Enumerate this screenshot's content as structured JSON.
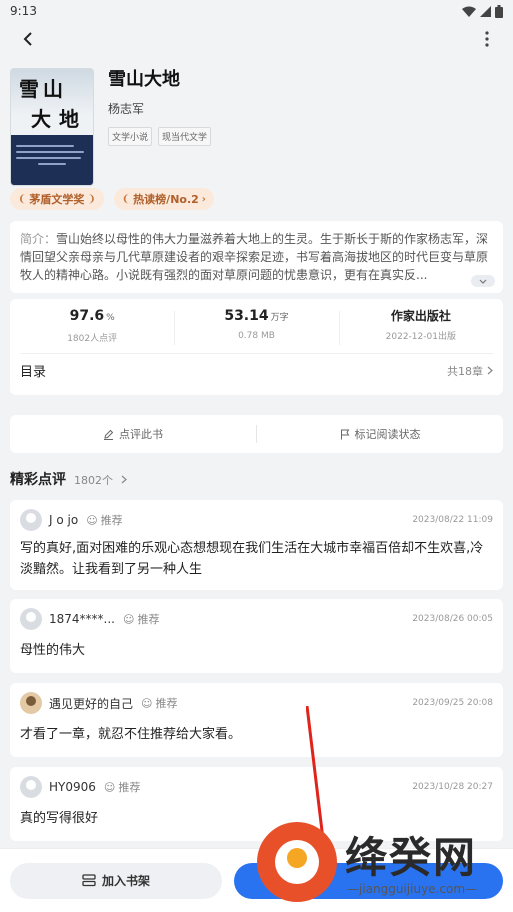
{
  "status_bar": {
    "time": "9:13"
  },
  "book": {
    "title": "雪山大地",
    "author": "杨志军",
    "tags": [
      "文学小说",
      "现当代文学"
    ],
    "cover": {
      "title_line1": "雪山",
      "title_line2": "大地"
    }
  },
  "badges": [
    {
      "label": "茅盾文学奖"
    },
    {
      "label": "热读榜/No.2"
    }
  ],
  "intro": {
    "lead": "简介：",
    "text": "雪山始终以母性的伟大力量滋养着大地上的生灵。生于斯长于斯的作家杨志军，深情回望父亲母亲与几代草原建设者的艰辛探索足迹，书写着高海拔地区的时代巨变与草原牧人的精神心路。小说既有强烈的面对草原问题的忧患意识，更有在真实反..."
  },
  "stats": [
    {
      "value": "97.6",
      "unit": "%",
      "sub": "1802人点评"
    },
    {
      "value": "53.14",
      "unit": "万字",
      "sub": "0.78 MB"
    },
    {
      "value": "作家出版社",
      "unit": "",
      "sub": "2022-12-01出版"
    }
  ],
  "toc": {
    "label": "目录",
    "count": "共18章"
  },
  "actions": {
    "review": "点评此书",
    "mark": "标记阅读状态"
  },
  "reviews_section": {
    "title": "精彩点评",
    "count": "1802个"
  },
  "reviews": [
    {
      "name": "J o jo",
      "rec": "推荐",
      "date": "2023/08/22 11:09",
      "text": "写的真好,面对困难的乐观心态想想现在我们生活在大城市幸福百倍却不生欢喜,冷淡黯然。让我看到了另一种人生"
    },
    {
      "name": "1874****...",
      "rec": "推荐",
      "date": "2023/08/26 00:05",
      "text": "母性的伟大"
    },
    {
      "name": "遇见更好的自己",
      "rec": "推荐",
      "date": "2023/09/25 20:08",
      "text": "才看了一章，就忍不住推荐给大家看。"
    },
    {
      "name": "HY0906",
      "rec": "推荐",
      "date": "2023/10/28 20:27",
      "text": "真的写得很好"
    }
  ],
  "bottom": {
    "shelf": "加入书架"
  },
  "watermark": {
    "name": "绛癸网",
    "url": "—jiangguijiuye.com—"
  },
  "colors": {
    "accent": "#2a73f0",
    "badge_bg": "#fbe9dc",
    "badge_text": "#b0602a"
  }
}
